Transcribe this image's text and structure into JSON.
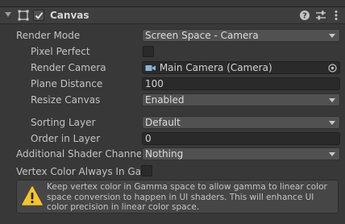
{
  "component": {
    "title": "Canvas",
    "enabled": true,
    "icons": [
      "rect-transform-icon",
      "help-icon",
      "presets-icon",
      "more-menu-icon"
    ]
  },
  "rows": {
    "render_mode": {
      "label": "Render Mode",
      "value": "Screen Space - Camera"
    },
    "pixel_perfect": {
      "label": "Pixel Perfect",
      "checked": false
    },
    "render_camera": {
      "label": "Render Camera",
      "value": "Main Camera (Camera)"
    },
    "plane_distance": {
      "label": "Plane Distance",
      "value": "100"
    },
    "resize_canvas": {
      "label": "Resize Canvas",
      "value": "Enabled"
    },
    "sorting_layer": {
      "label": "Sorting Layer",
      "value": "Default"
    },
    "order_in_layer": {
      "label": "Order in Layer",
      "value": "0"
    },
    "shader_channels": {
      "label": "Additional Shader Channels",
      "value": "Nothing"
    },
    "vertex_color": {
      "label": "Vertex Color Always In Gam",
      "checked": false
    }
  },
  "warning": {
    "text": "Keep vertex color in Gamma space to allow gamma to linear color space conversion to happen in UI shaders. This will enhance UI color precision in linear color space."
  },
  "colors": {
    "background": "#383838",
    "field": "#2a2a2a",
    "dropdown": "#515151",
    "warning_yellow": "#f4c430"
  }
}
